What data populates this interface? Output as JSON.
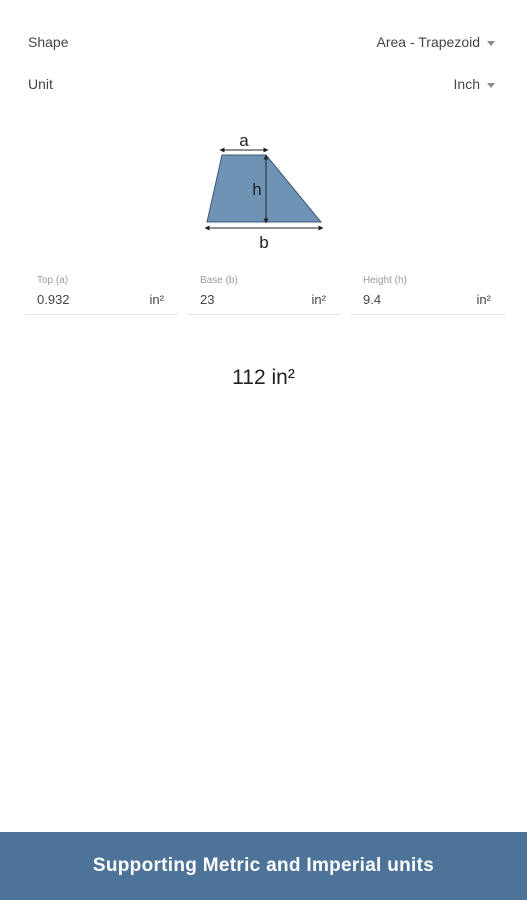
{
  "settings": {
    "shape_label": "Shape",
    "shape_value": "Area - Trapezoid",
    "unit_label": "Unit",
    "unit_value": "Inch"
  },
  "diagram": {
    "label_a": "a",
    "label_b": "b",
    "label_h": "h",
    "fill_color": "#6f93b5"
  },
  "inputs": [
    {
      "label": "Top (a)",
      "value": "0.932",
      "unit": "in²"
    },
    {
      "label": "Base (b)",
      "value": "23",
      "unit": "in²"
    },
    {
      "label": "Height (h)",
      "value": "9.4",
      "unit": "in²"
    }
  ],
  "result": "112 in²",
  "banner": "Supporting Metric and Imperial units",
  "colors": {
    "banner_bg": "#4e7398",
    "shape_fill": "#6f93b5"
  }
}
